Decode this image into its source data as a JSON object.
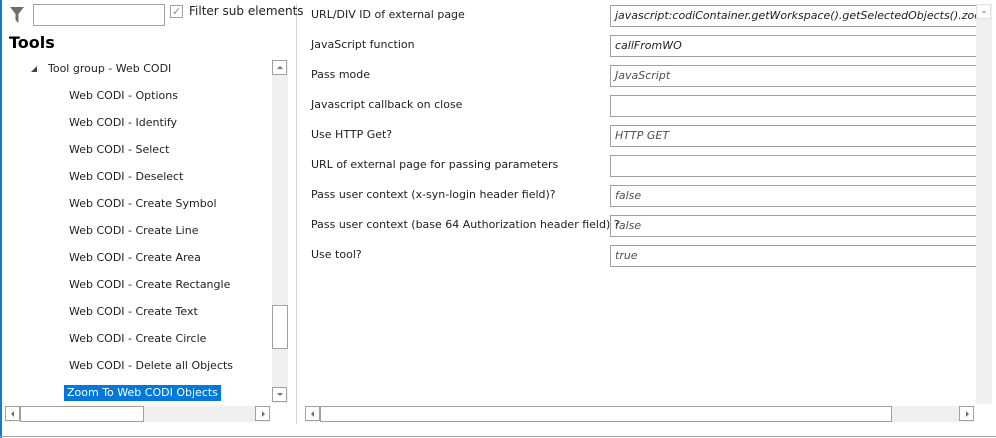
{
  "left": {
    "search": {
      "value": "",
      "placeholder": ""
    },
    "filter_sub_elements": {
      "label": "Filter sub elements",
      "checked": true
    },
    "title": "Tools",
    "group": {
      "label": "Tool group - Web CODI",
      "expanded": true
    },
    "items": [
      {
        "label": "Web CODI - Options"
      },
      {
        "label": "Web CODI - Identify"
      },
      {
        "label": "Web CODI - Select"
      },
      {
        "label": "Web CODI - Deselect"
      },
      {
        "label": "Web CODI - Create Symbol"
      },
      {
        "label": "Web CODI - Create Line"
      },
      {
        "label": "Web CODI - Create Area"
      },
      {
        "label": "Web CODI - Create Rectangle"
      },
      {
        "label": "Web CODI - Create Text"
      },
      {
        "label": "Web CODI - Create Circle"
      },
      {
        "label": "Web CODI - Delete all Objects"
      },
      {
        "label": "Zoom To Web CODI Objects",
        "selected": true
      }
    ]
  },
  "properties": [
    {
      "label": "URL/DIV ID of external page",
      "value": "javascript:codiContainer.getWorkspace().getSelectedObjects().zoomTo()"
    },
    {
      "label": "JavaScript function",
      "value": "callFromWO"
    },
    {
      "label": "Pass mode",
      "value": "JavaScript",
      "readonly": true
    },
    {
      "label": "Javascript callback on close",
      "value": ""
    },
    {
      "label": "Use HTTP Get?",
      "value": "HTTP GET",
      "readonly": true
    },
    {
      "label": "URL of external page for passing parameters",
      "value": ""
    },
    {
      "label": "Pass user context (x-syn-login header field)?",
      "value": "false",
      "readonly": true
    },
    {
      "label": "Pass user context (base 64 Authorization header field) ?",
      "value": "false",
      "readonly": true
    },
    {
      "label": "Use tool?",
      "value": "true",
      "readonly": true
    }
  ],
  "icons": {
    "filter": "funnel-icon",
    "check": "checkmark-icon",
    "expand": "triangle-expanded-icon"
  },
  "colors": {
    "selection": "#0078d7",
    "accent_edge": "#1979ca"
  }
}
